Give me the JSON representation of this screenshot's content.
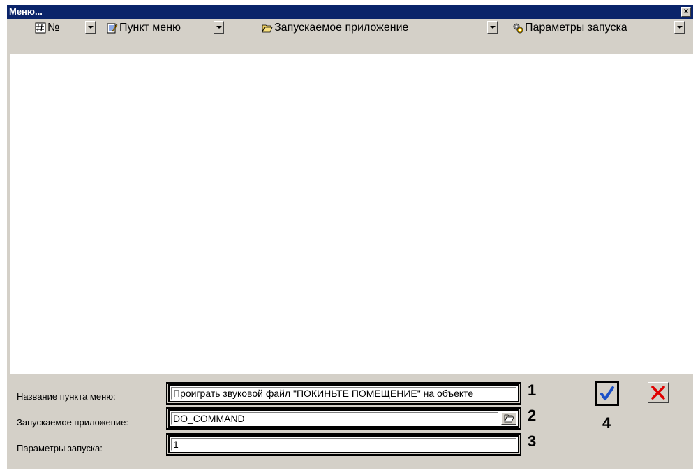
{
  "window": {
    "title": "Меню..."
  },
  "columns": [
    {
      "label": "№",
      "icon": "hash-icon"
    },
    {
      "label": "Пункт меню",
      "icon": "edit-icon"
    },
    {
      "label": "Запускаемое приложение",
      "icon": "open-folder-icon"
    },
    {
      "label": "Параметры запуска",
      "icon": "gears-icon"
    }
  ],
  "form": {
    "menu_item_name": {
      "label": "Название пункта меню:",
      "value": "Проиграть звуковой файл \"ПОКИНЬТЕ ПОМЕЩЕНИЕ\" на объекте",
      "callout": "1"
    },
    "application": {
      "label": "Запускаемое приложение:",
      "value": "DO_COMMAND",
      "callout": "2"
    },
    "parameters": {
      "label": "Параметры запуска:",
      "value": "1",
      "callout": "3"
    },
    "ok_callout": "4"
  },
  "colors": {
    "titlebar": "#0a246a",
    "face": "#d4d0c8",
    "ok_check": "#1a50c8",
    "cancel_x": "#e00000"
  }
}
